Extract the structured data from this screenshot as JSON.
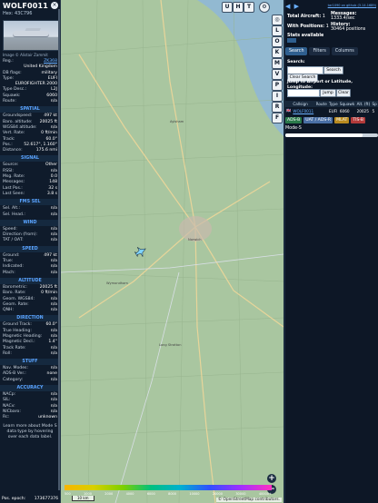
{
  "aircraft": {
    "callsign": "WOLF0011",
    "hex_line": "Hex: 43C796",
    "photo_caption": "Image © Alistair Zammit"
  },
  "details": [
    {
      "k": "Reg.:",
      "v": "ZK368",
      "link": true
    },
    {
      "k": "",
      "v": "United Kingdom"
    },
    {
      "k": "DB flags:",
      "v": "military"
    },
    {
      "k": "Type:",
      "v": "EUFI"
    },
    {
      "k": "",
      "v": "EUROFIGHTER 2000"
    },
    {
      "k": "Type Desc.:",
      "v": "L2J"
    },
    {
      "k": "Squawk:",
      "v": "6060"
    },
    {
      "k": "Route:",
      "v": "n/a"
    }
  ],
  "sections": [
    {
      "title": "SPATIAL",
      "rows": [
        {
          "k": "Groundspeed:",
          "v": "497 kt"
        },
        {
          "k": "Baro. altitude:",
          "v": "20025 ft"
        },
        {
          "k": "WGS84 altitude:",
          "v": "n/a"
        },
        {
          "k": "Vert. Rate:",
          "v": "0 ft/min"
        },
        {
          "k": "Track:",
          "v": "60.0°"
        },
        {
          "k": "Pos.:",
          "v": "52.617°, 1.160°"
        },
        {
          "k": "Distance:",
          "v": "175.6 nmi"
        }
      ]
    },
    {
      "title": "SIGNAL",
      "rows": [
        {
          "k": "Source:",
          "v": "Other"
        },
        {
          "k": "RSSI:",
          "v": "n/a"
        },
        {
          "k": "Msg. Rate:",
          "v": "0.0"
        },
        {
          "k": "Messages:",
          "v": "148"
        },
        {
          "k": "Last Pos.:",
          "v": "32 s"
        },
        {
          "k": "Last Seen:",
          "v": "3.8 s"
        }
      ]
    },
    {
      "title": "FMS SEL",
      "rows": [
        {
          "k": "Sel. Alt.:",
          "v": "n/a"
        },
        {
          "k": "Sel. Head.:",
          "v": "n/a"
        }
      ]
    },
    {
      "title": "WIND",
      "rows": [
        {
          "k": "Speed:",
          "v": "n/a"
        },
        {
          "k": "Direction (from):",
          "v": "n/a"
        },
        {
          "k": "TAT / OAT:",
          "v": "n/a"
        }
      ]
    },
    {
      "title": "SPEED",
      "rows": [
        {
          "k": "Ground:",
          "v": "497 kt"
        },
        {
          "k": "True:",
          "v": "n/a"
        },
        {
          "k": "Indicated:",
          "v": "n/a"
        },
        {
          "k": "Mach:",
          "v": "n/a"
        }
      ]
    },
    {
      "title": "ALTITUDE",
      "rows": [
        {
          "k": "Barometric:",
          "v": "20025 ft"
        },
        {
          "k": "Baro. Rate:",
          "v": "0 ft/min"
        },
        {
          "k": "Geom. WGS84:",
          "v": "n/a"
        },
        {
          "k": "Geom. Rate:",
          "v": "n/a"
        },
        {
          "k": "QNH:",
          "v": "n/a"
        }
      ]
    },
    {
      "title": "DIRECTION",
      "rows": [
        {
          "k": "Ground Track:",
          "v": "60.0°"
        },
        {
          "k": "True Heading:",
          "v": "n/a"
        },
        {
          "k": "Magnetic Heading:",
          "v": "n/a"
        },
        {
          "k": "Magnetic Decl.:",
          "v": "1.4°"
        },
        {
          "k": "Track Rate:",
          "v": "n/a"
        },
        {
          "k": "Roll:",
          "v": "n/a"
        }
      ]
    },
    {
      "title": "STUFF",
      "rows": [
        {
          "k": "Nav. Modes:",
          "v": "n/a"
        },
        {
          "k": "ADS-B Ver.:",
          "v": "none"
        },
        {
          "k": "Category:",
          "v": "n/a"
        }
      ]
    },
    {
      "title": "ACCURACY",
      "rows": [
        {
          "k": "NACp:",
          "v": "n/a"
        },
        {
          "k": "SIL:",
          "v": "n/a"
        },
        {
          "k": "NACv:",
          "v": "n/a"
        },
        {
          "k": "NICbaro:",
          "v": "n/a"
        },
        {
          "k": "Rc:",
          "v": "unknown"
        }
      ]
    }
  ],
  "learn_more": "Learn more about Mode S data type by hovering over each data label.",
  "epoch": {
    "label": "Pos. epoch:",
    "value": "173677376"
  },
  "map": {
    "top_buttons": [
      "U",
      "H",
      "T"
    ],
    "side_buttons": [
      "L",
      "O",
      "K",
      "M",
      "P",
      "I",
      "R",
      "F"
    ],
    "side_button_letters_mid": [
      "V"
    ],
    "altitude_ticks": [
      "500",
      "1000",
      "2000",
      "4000",
      "6000",
      "8000",
      "10000",
      "20000",
      "30000",
      "40000+"
    ],
    "scale_label": "10 km",
    "attribution": "© OpenStreetMap contributors.",
    "places": [
      {
        "name": "Norwich"
      },
      {
        "name": "Wymondham"
      },
      {
        "name": "Long Stratton"
      },
      {
        "name": "Aylsham"
      }
    ],
    "colors": {
      "water": "#8fb7d6",
      "land": "#a9c6a0",
      "road": "#e8d59a"
    }
  },
  "right_panel": {
    "version_link": "tar1090 on github (3.14.1689)",
    "total_aircraft_label": "Total Aircraft:",
    "total_aircraft_value": "1",
    "with_positions_label": "With Positions:",
    "with_positions_value": "1",
    "stats_label": "Stats available",
    "messages_label": "Messages:",
    "messages_value": "1333.4/sec",
    "history_label": "History:",
    "history_value": "30464 positions",
    "tabs": [
      "Search",
      "Filters",
      "Columns"
    ],
    "search_label": "Search:",
    "search_button": "Search",
    "clear_button": "Clear Search",
    "jump_label": "Jump to Airport or Latitude, Longitude:",
    "jump_button": "Jump",
    "clear2_button": "Clear",
    "columns": [
      "",
      "Callsign",
      "Route",
      "Type",
      "Squawk",
      "Alt. (ft)",
      "Sp"
    ],
    "rows": [
      {
        "flag": "🇬🇧",
        "callsign": "WOLF0011",
        "route": "",
        "type": "EUFI",
        "squawk": "6060",
        "alt": "20025",
        "sp": "5"
      }
    ],
    "tags": [
      {
        "text": "ADS-B",
        "color": "#2b7a4b"
      },
      {
        "text": "UAT / ADS-R",
        "color": "#4a6fa5"
      },
      {
        "text": "MLAT",
        "color": "#b88a1f"
      },
      {
        "text": "TIS-B",
        "color": "#b23a3a"
      }
    ],
    "modes_label": "Mode-S"
  }
}
